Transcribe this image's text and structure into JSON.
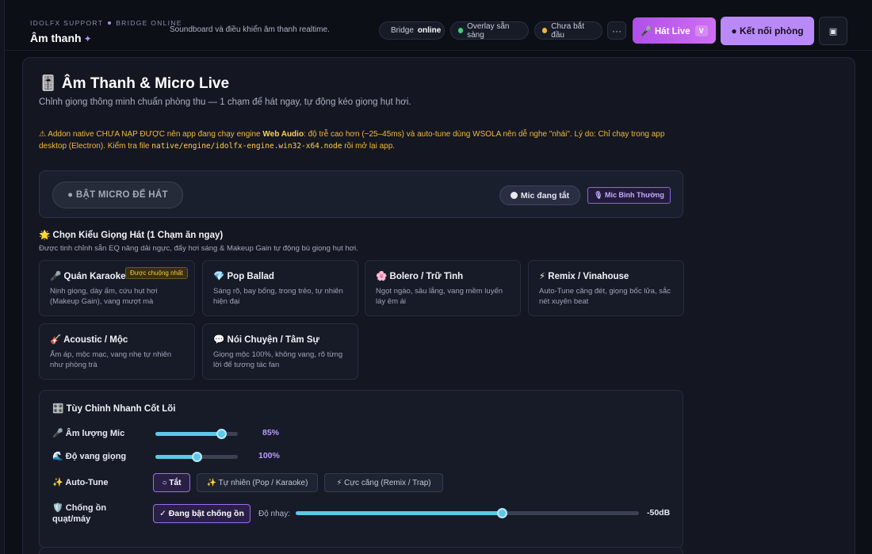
{
  "header": {
    "kicker_left": "IDOLFX SUPPORT",
    "kicker_right": "BRIDGE ONLINE",
    "title": "Âm thanh",
    "title_spark": "✦",
    "tagline": "Soundboard và điều khiển âm thanh realtime.",
    "pills": [
      {
        "prefix": "Bridge",
        "strong": "online",
        "color": "#3ecf7c"
      },
      {
        "prefix": "Overlay sẵn sàng",
        "strong": "",
        "color": "#3ecf7c"
      },
      {
        "prefix": "Chưa bắt đầu",
        "strong": "",
        "color": "#f2b835"
      }
    ],
    "more_label": "···",
    "hat_live_label": "🎤 Hát Live",
    "hat_live_shortcut": "V",
    "connect_label": "● Kết nối phòng",
    "square_label": "▣"
  },
  "main": {
    "title": "🎚️ Âm Thanh & Micro Live",
    "subtitle": "Chỉnh giọng thông minh chuẩn phòng thu — 1 chạm để hát ngay, tự động kéo giọng hụt hơi.",
    "warning": {
      "lead": "⚠ Addon native CHƯA NẠP ĐƯỢC nên app đang chạy engine ",
      "engine": "Web Audio",
      "mid": ": độ trễ cao hơn (~25–45ms) và auto-tune dùng WSOLA nên dễ nghe \"nhái\". Lý do: Chỉ chạy trong app desktop (Electron). Kiểm tra file ",
      "file": "native/engine/idolfx-engine.win32-x64.node",
      "tail": " rồi mở lại app."
    },
    "mic": {
      "toggle_label": "● BẬT MICRO ĐỂ HÁT",
      "status_label": "Mic đang tắt",
      "mode_label": "🎙 Mic Bình Thường"
    },
    "styles": {
      "title": "🌟 Chọn Kiểu Giọng Hát (1 Chạm ăn ngay)",
      "subtitle": "Được tinh chỉnh sẵn EQ nâng dải ngực, đẩy hơi sáng & Makeup Gain tự động bù giọng hụt hơi.",
      "badge": "Được chuộng nhất",
      "cards": [
        {
          "title": "🎤 Quán Karaoke Pro",
          "desc": "Nịnh giọng, dày ấm, cứu hụt hơi (Makeup Gain), vang mượt mà"
        },
        {
          "title": "💎 Pop Ballad",
          "desc": "Sáng rõ, bay bổng, trong trẻo, tự nhiên hiện đại"
        },
        {
          "title": "🌸 Bolero / Trữ Tình",
          "desc": "Ngọt ngào, sâu lắng, vang mềm luyến láy êm ái"
        },
        {
          "title": "⚡ Remix / Vinahouse",
          "desc": "Auto-Tune căng đét, giọng bốc lửa, sắc nét xuyên beat"
        },
        {
          "title": "🎸 Acoustic / Mộc",
          "desc": "Ấm áp, mộc mạc, vang nhẹ tự nhiên như phòng trà"
        },
        {
          "title": "💬 Nói Chuyện / Tâm Sự",
          "desc": "Giọng mộc 100%, không vang, rõ từng lời để tương tác fan"
        }
      ]
    },
    "tune": {
      "title": "🎛️ Tùy Chỉnh Nhanh Cốt Lõi",
      "mic_volume_label": "🎤 Âm lượng Mic",
      "mic_volume_value": "85%",
      "mic_volume": 0.8,
      "reverb_label": "🌊 Độ vang giọng",
      "reverb_value": "100%",
      "reverb": 0.5,
      "autotune_label": "✨ Auto-Tune",
      "autotune_options": [
        "○ Tắt",
        "✨ Tự nhiên (Pop / Karaoke)",
        "⚡ Cực căng (Remix / Trap)"
      ],
      "noise_label_1": "🛡️ Chống ồn",
      "noise_label_2": "quạt/máy",
      "noise_button": "✓ Đang bật chống ồn",
      "sensitivity_label": "Độ nhạy:",
      "sensitivity_value": "-50dB",
      "sensitivity": 0.6
    }
  }
}
